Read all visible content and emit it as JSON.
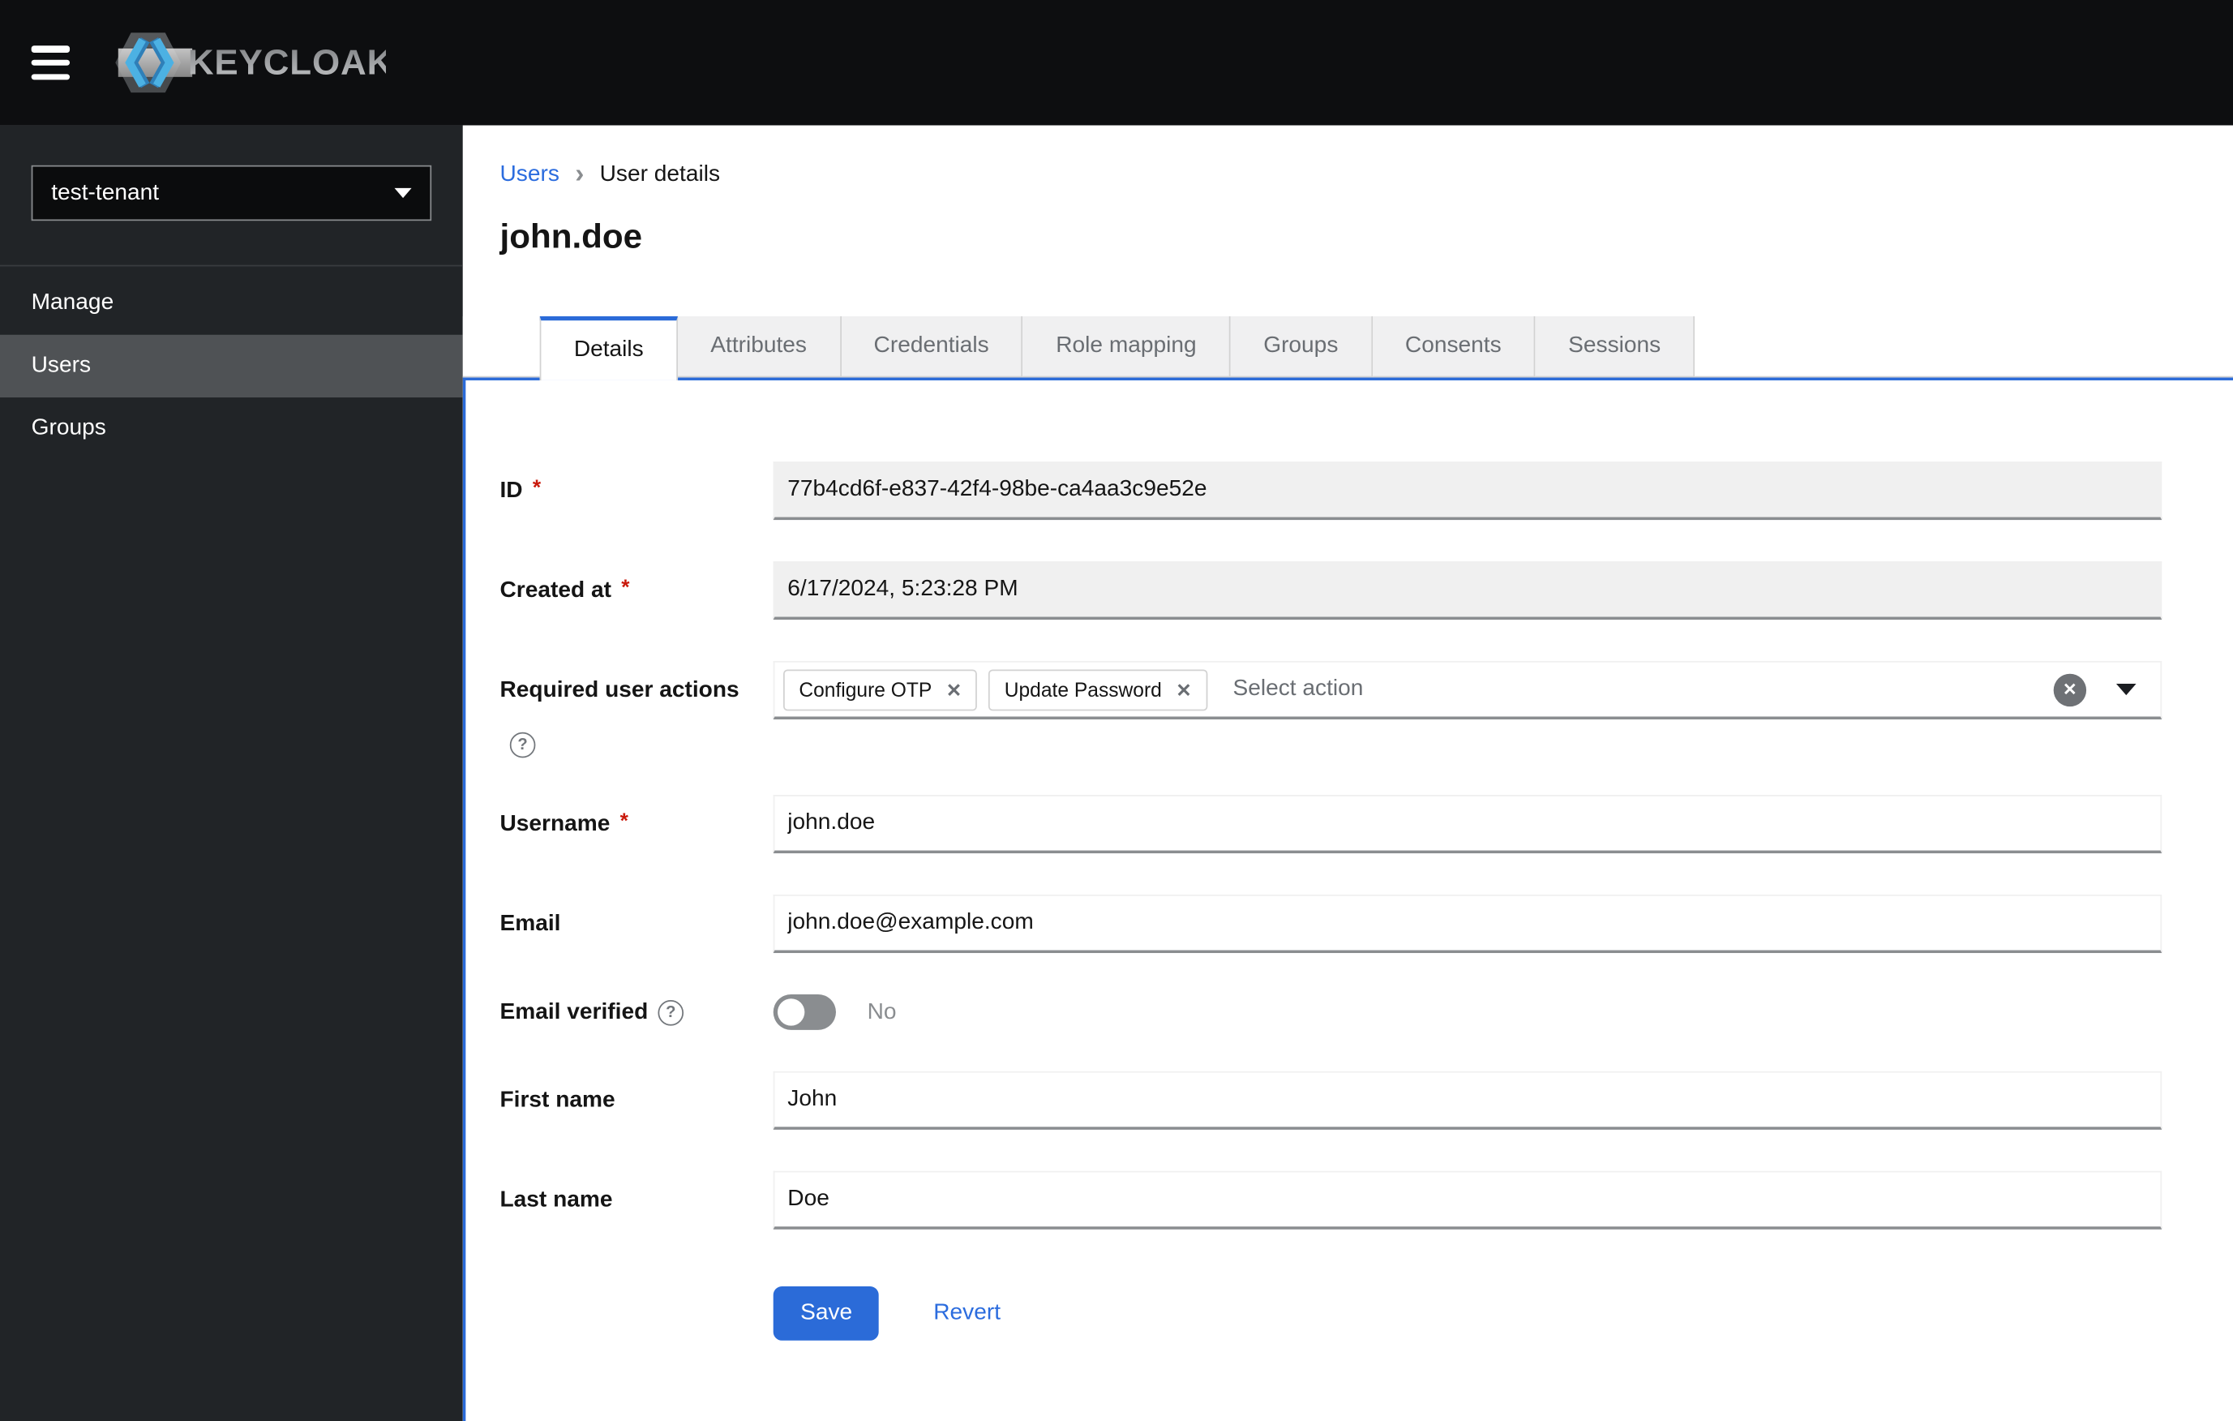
{
  "colors": {
    "accent": "#2b6bd8",
    "link": "#2b6cde",
    "header-bg": "#0d0e10",
    "sidebar-bg": "#212427",
    "nav-selected": "#4f5255",
    "input-border": "#8a8d90",
    "readonly-bg": "#f0f0f0",
    "tab-inactive-bg": "#f0f0f1",
    "tab-text": "#6a6e73",
    "required": "#c9190b"
  },
  "header": {
    "brand": "KEYCLOAK"
  },
  "sidebar": {
    "realm_selector": {
      "value": "test-tenant"
    },
    "section_label": "Manage",
    "items": [
      {
        "label": "Users",
        "selected": true
      },
      {
        "label": "Groups",
        "selected": false
      }
    ]
  },
  "breadcrumb": {
    "separator": "›",
    "items": [
      {
        "label": "Users"
      },
      {
        "label": "User details"
      }
    ]
  },
  "page": {
    "title": "john.doe"
  },
  "tabs": [
    {
      "label": "Details",
      "active": true
    },
    {
      "label": "Attributes",
      "active": false
    },
    {
      "label": "Credentials",
      "active": false
    },
    {
      "label": "Role mapping",
      "active": false
    },
    {
      "label": "Groups",
      "active": false
    },
    {
      "label": "Consents",
      "active": false
    },
    {
      "label": "Sessions",
      "active": false
    }
  ],
  "form": {
    "required_marker": "*",
    "id": {
      "label": "ID",
      "value": "77b4cd6f-e837-42f4-98be-ca4aa3c9e52e",
      "required": true,
      "readonly": true
    },
    "created_at": {
      "label": "Created at",
      "value": "6/17/2024, 5:23:28 PM",
      "required": true,
      "readonly": true
    },
    "required_user_actions": {
      "label": "Required user actions",
      "chips": [
        {
          "label": "Configure OTP"
        },
        {
          "label": "Update Password"
        }
      ],
      "placeholder": "Select action"
    },
    "username": {
      "label": "Username",
      "value": "john.doe",
      "required": true
    },
    "email": {
      "label": "Email",
      "value": "john.doe@example.com"
    },
    "email_verified": {
      "label": "Email verified",
      "state_text": "No",
      "enabled": false
    },
    "first_name": {
      "label": "First name",
      "value": "John"
    },
    "last_name": {
      "label": "Last name",
      "value": "Doe"
    }
  },
  "actions": {
    "save": "Save",
    "revert": "Revert"
  },
  "icons": {
    "help": "?",
    "clear": "✕",
    "chip_remove": "✕"
  }
}
